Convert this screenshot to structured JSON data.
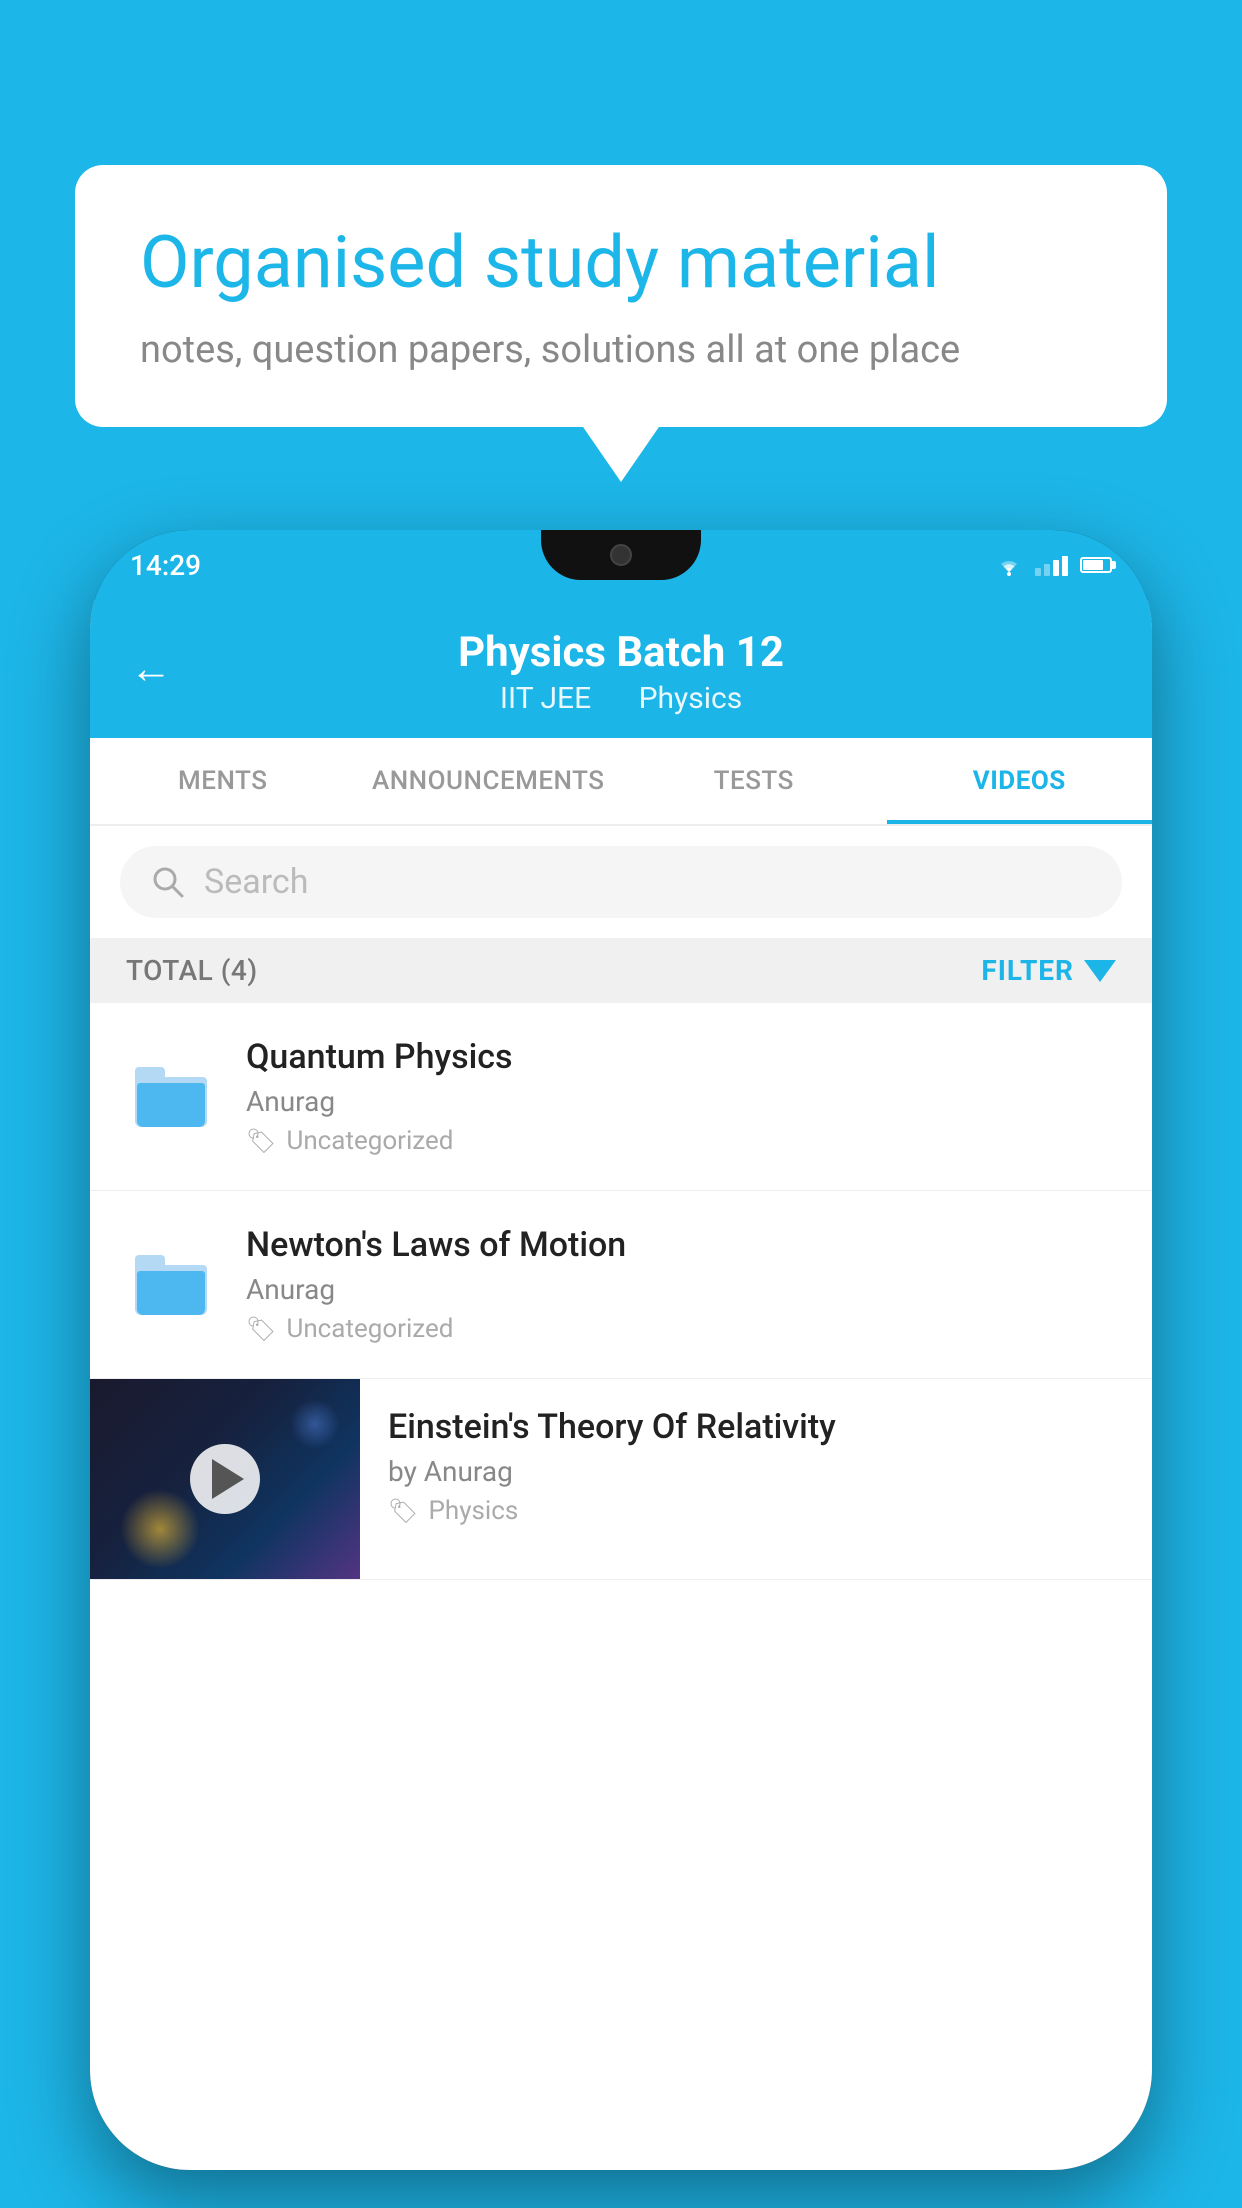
{
  "background": {
    "color": "#1db6e8"
  },
  "speechBubble": {
    "title": "Organised study material",
    "subtitle": "notes, question papers, solutions all at one place"
  },
  "phone": {
    "statusBar": {
      "time": "14:29"
    },
    "header": {
      "title": "Physics Batch 12",
      "subtitle1": "IIT JEE",
      "subtitle2": "Physics",
      "backLabel": "←"
    },
    "tabs": [
      {
        "label": "MENTS",
        "active": false
      },
      {
        "label": "ANNOUNCEMENTS",
        "active": false
      },
      {
        "label": "TESTS",
        "active": false
      },
      {
        "label": "VIDEOS",
        "active": true
      }
    ],
    "search": {
      "placeholder": "Search"
    },
    "filterRow": {
      "total": "TOTAL (4)",
      "filterLabel": "FILTER"
    },
    "videos": [
      {
        "title": "Quantum Physics",
        "author": "Anurag",
        "tag": "Uncategorized",
        "type": "folder"
      },
      {
        "title": "Newton's Laws of Motion",
        "author": "Anurag",
        "tag": "Uncategorized",
        "type": "folder"
      },
      {
        "title": "Einstein's Theory Of Relativity",
        "author": "by Anurag",
        "tag": "Physics",
        "type": "thumbnail"
      }
    ]
  }
}
